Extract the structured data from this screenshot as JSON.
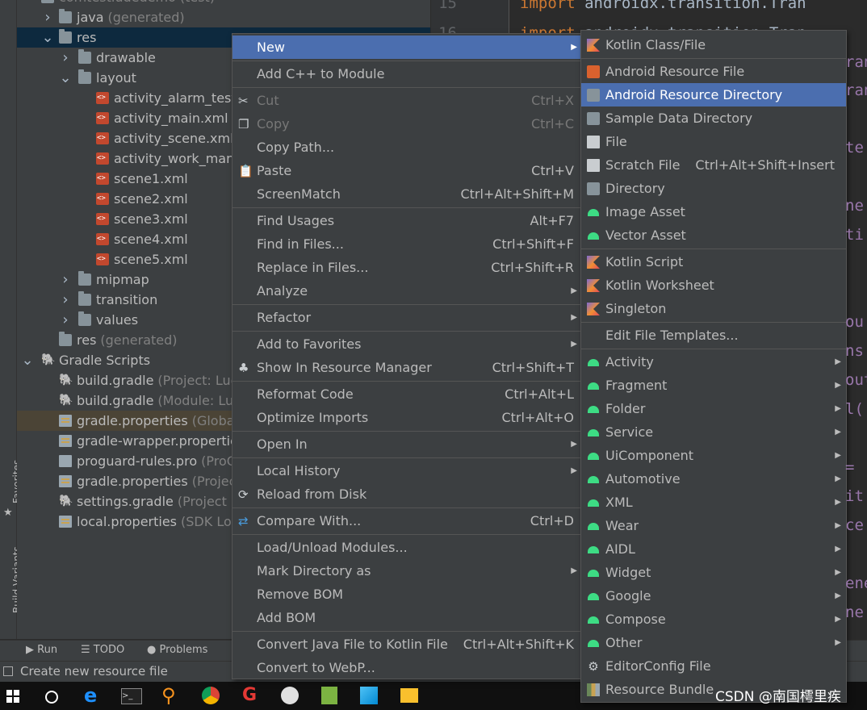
{
  "project_tree": [
    {
      "label": "comtestludedemo",
      "sub": "(test)",
      "indent": 0,
      "arrow": "",
      "icon": "folder",
      "partial": true
    },
    {
      "label": "java",
      "sub": "(generated)",
      "indent": 1,
      "arrow": ">",
      "icon": "folder"
    },
    {
      "label": "res",
      "sub": "",
      "indent": 1,
      "arrow": "v",
      "icon": "folder",
      "selected": true
    },
    {
      "label": "drawable",
      "sub": "",
      "indent": 2,
      "arrow": ">",
      "icon": "folder"
    },
    {
      "label": "layout",
      "sub": "",
      "indent": 2,
      "arrow": "v",
      "icon": "folder"
    },
    {
      "label": "activity_alarm_test.xml",
      "sub": "",
      "indent": 3,
      "arrow": "",
      "icon": "xml"
    },
    {
      "label": "activity_main.xml",
      "sub": "",
      "indent": 3,
      "arrow": "",
      "icon": "xml"
    },
    {
      "label": "activity_scene.xml",
      "sub": "",
      "indent": 3,
      "arrow": "",
      "icon": "xml"
    },
    {
      "label": "activity_work_manager.xml",
      "sub": "",
      "indent": 3,
      "arrow": "",
      "icon": "xml"
    },
    {
      "label": "scene1.xml",
      "sub": "",
      "indent": 3,
      "arrow": "",
      "icon": "xml"
    },
    {
      "label": "scene2.xml",
      "sub": "",
      "indent": 3,
      "arrow": "",
      "icon": "xml"
    },
    {
      "label": "scene3.xml",
      "sub": "",
      "indent": 3,
      "arrow": "",
      "icon": "xml"
    },
    {
      "label": "scene4.xml",
      "sub": "",
      "indent": 3,
      "arrow": "",
      "icon": "xml"
    },
    {
      "label": "scene5.xml",
      "sub": "",
      "indent": 3,
      "arrow": "",
      "icon": "xml"
    },
    {
      "label": "mipmap",
      "sub": "",
      "indent": 2,
      "arrow": ">",
      "icon": "folder"
    },
    {
      "label": "transition",
      "sub": "",
      "indent": 2,
      "arrow": ">",
      "icon": "folder"
    },
    {
      "label": "values",
      "sub": "",
      "indent": 2,
      "arrow": ">",
      "icon": "folder"
    },
    {
      "label": "res",
      "sub": "(generated)",
      "indent": 1,
      "arrow": "",
      "icon": "folder"
    },
    {
      "label": "Gradle Scripts",
      "sub": "",
      "indent": 0,
      "arrow": "v",
      "icon": "gradle"
    },
    {
      "label": "build.gradle",
      "sub": "(Project: Luo",
      "indent": 1,
      "arrow": "",
      "icon": "gradle"
    },
    {
      "label": "build.gradle",
      "sub": "(Module: Lud",
      "indent": 1,
      "arrow": "",
      "icon": "gradle"
    },
    {
      "label": "gradle.properties",
      "sub": "(Global",
      "indent": 1,
      "arrow": "",
      "icon": "props",
      "highlight": true
    },
    {
      "label": "gradle-wrapper.properties",
      "sub": "",
      "indent": 1,
      "arrow": "",
      "icon": "props"
    },
    {
      "label": "proguard-rules.pro",
      "sub": "(ProGu",
      "indent": 1,
      "arrow": "",
      "icon": "file"
    },
    {
      "label": "gradle.properties",
      "sub": "(Project",
      "indent": 1,
      "arrow": "",
      "icon": "props"
    },
    {
      "label": "settings.gradle",
      "sub": "(Project Se",
      "indent": 1,
      "arrow": "",
      "icon": "gradle"
    },
    {
      "label": "local.properties",
      "sub": "(SDK Loca",
      "indent": 1,
      "arrow": "",
      "icon": "props"
    }
  ],
  "editor": {
    "line_numbers": [
      "15",
      "16"
    ],
    "lines": [
      {
        "kw": "import",
        "text": " androidx.transition.Tran"
      },
      {
        "kw": "import",
        "text": " androidx.transition.Tran"
      }
    ],
    "right_fragments": [
      "ran",
      "ran",
      "te",
      "ne",
      "ti",
      "ou",
      "ns",
      "out",
      "l(",
      "=",
      "it",
      "ce",
      "ene",
      "ne"
    ]
  },
  "left_stripe": {
    "favorites": "Favorites",
    "build_variants": "Build Variants"
  },
  "bottom_tools": [
    {
      "icon": "run-icon",
      "label": "Run"
    },
    {
      "icon": "todo-icon",
      "label": "TODO"
    },
    {
      "icon": "problems-icon",
      "label": "Problems"
    }
  ],
  "status_bar": {
    "text": "Create new resource file"
  },
  "watermark": "CSDN @南国樗里疾",
  "context_menu": [
    {
      "label": "New",
      "shortcut": "",
      "arrow": true,
      "selected": true,
      "icon": ""
    },
    {
      "sep": true
    },
    {
      "label": "Add C++ to Module",
      "shortcut": "",
      "icon": ""
    },
    {
      "sep": true
    },
    {
      "label": "Cut",
      "shortcut": "Ctrl+X",
      "disabled": true,
      "icon": "cut-icon"
    },
    {
      "label": "Copy",
      "shortcut": "Ctrl+C",
      "disabled": true,
      "icon": "copy-icon"
    },
    {
      "label": "Copy Path...",
      "shortcut": "",
      "icon": ""
    },
    {
      "label": "Paste",
      "shortcut": "Ctrl+V",
      "icon": "paste-icon"
    },
    {
      "label": "ScreenMatch",
      "shortcut": "Ctrl+Alt+Shift+M",
      "icon": ""
    },
    {
      "sep": true
    },
    {
      "label": "Find Usages",
      "shortcut": "Alt+F7",
      "icon": ""
    },
    {
      "label": "Find in Files...",
      "shortcut": "Ctrl+Shift+F",
      "icon": ""
    },
    {
      "label": "Replace in Files...",
      "shortcut": "Ctrl+Shift+R",
      "icon": ""
    },
    {
      "label": "Analyze",
      "shortcut": "",
      "arrow": true,
      "icon": ""
    },
    {
      "sep": true
    },
    {
      "label": "Refactor",
      "shortcut": "",
      "arrow": true,
      "icon": ""
    },
    {
      "sep": true
    },
    {
      "label": "Add to Favorites",
      "shortcut": "",
      "arrow": true,
      "icon": ""
    },
    {
      "label": "Show In Resource Manager",
      "shortcut": "Ctrl+Shift+T",
      "icon": "resource-manager-icon"
    },
    {
      "sep": true
    },
    {
      "label": "Reformat Code",
      "shortcut": "Ctrl+Alt+L",
      "icon": ""
    },
    {
      "label": "Optimize Imports",
      "shortcut": "Ctrl+Alt+O",
      "icon": ""
    },
    {
      "sep": true
    },
    {
      "label": "Open In",
      "shortcut": "",
      "arrow": true,
      "icon": ""
    },
    {
      "sep": true
    },
    {
      "label": "Local History",
      "shortcut": "",
      "arrow": true,
      "icon": ""
    },
    {
      "label": "Reload from Disk",
      "shortcut": "",
      "icon": "reload-icon"
    },
    {
      "sep": true
    },
    {
      "label": "Compare With...",
      "shortcut": "Ctrl+D",
      "icon": "compare-icon"
    },
    {
      "sep": true
    },
    {
      "label": "Load/Unload Modules...",
      "shortcut": "",
      "icon": ""
    },
    {
      "label": "Mark Directory as",
      "shortcut": "",
      "arrow": true,
      "icon": ""
    },
    {
      "label": "Remove BOM",
      "shortcut": "",
      "icon": ""
    },
    {
      "label": "Add BOM",
      "shortcut": "",
      "icon": ""
    },
    {
      "sep": true
    },
    {
      "label": "Convert Java File to Kotlin File",
      "shortcut": "Ctrl+Alt+Shift+K",
      "icon": ""
    },
    {
      "label": "Convert to WebP...",
      "shortcut": "",
      "icon": ""
    }
  ],
  "new_submenu": [
    {
      "label": "Kotlin Class/File",
      "icon": "kotlin-icon"
    },
    {
      "sep": true
    },
    {
      "label": "Android Resource File",
      "icon": "resource-file-icon"
    },
    {
      "label": "Android Resource Directory",
      "icon": "folder-icon",
      "selected": true
    },
    {
      "label": "Sample Data Directory",
      "icon": "folder-icon"
    },
    {
      "label": "File",
      "icon": "file-icon"
    },
    {
      "label": "Scratch File",
      "shortcut": "Ctrl+Alt+Shift+Insert",
      "icon": "scratch-file-icon"
    },
    {
      "label": "Directory",
      "icon": "folder-icon"
    },
    {
      "label": "Image Asset",
      "icon": "android-icon"
    },
    {
      "label": "Vector Asset",
      "icon": "android-icon"
    },
    {
      "sep": true
    },
    {
      "label": "Kotlin Script",
      "icon": "kotlin-icon"
    },
    {
      "label": "Kotlin Worksheet",
      "icon": "kotlin-icon"
    },
    {
      "label": "Singleton",
      "icon": "kotlin-icon"
    },
    {
      "sep": true
    },
    {
      "label": "Edit File Templates...",
      "icon": ""
    },
    {
      "sep": true
    },
    {
      "label": "Activity",
      "icon": "android-icon",
      "arrow": true
    },
    {
      "label": "Fragment",
      "icon": "android-icon",
      "arrow": true
    },
    {
      "label": "Folder",
      "icon": "android-icon",
      "arrow": true
    },
    {
      "label": "Service",
      "icon": "android-icon",
      "arrow": true
    },
    {
      "label": "UiComponent",
      "icon": "android-icon",
      "arrow": true
    },
    {
      "label": "Automotive",
      "icon": "android-icon",
      "arrow": true
    },
    {
      "label": "XML",
      "icon": "android-icon",
      "arrow": true
    },
    {
      "label": "Wear",
      "icon": "android-icon",
      "arrow": true
    },
    {
      "label": "AIDL",
      "icon": "android-icon",
      "arrow": true
    },
    {
      "label": "Widget",
      "icon": "android-icon",
      "arrow": true
    },
    {
      "label": "Google",
      "icon": "android-icon",
      "arrow": true
    },
    {
      "label": "Compose",
      "icon": "android-icon",
      "arrow": true
    },
    {
      "label": "Other",
      "icon": "android-icon",
      "arrow": true
    },
    {
      "label": "EditorConfig File",
      "icon": "gear-icon"
    },
    {
      "label": "Resource Bundle",
      "icon": "resource-bundle-icon"
    }
  ],
  "colors": {
    "selection": "#4b6eaf",
    "panel": "#3c3f41",
    "android": "#3ddc84",
    "keyword": "#cc7832"
  }
}
